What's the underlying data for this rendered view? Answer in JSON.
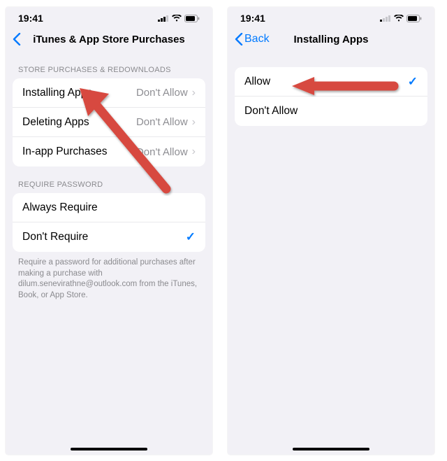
{
  "status": {
    "time": "19:41"
  },
  "left": {
    "nav_title": "iTunes & App Store Purchases",
    "section1_header": "Store Purchases & Redownloads",
    "rows1": [
      {
        "label": "Installing Apps",
        "value": "Don't Allow"
      },
      {
        "label": "Deleting Apps",
        "value": "Don't Allow"
      },
      {
        "label": "In-app Purchases",
        "value": "Don't Allow"
      }
    ],
    "section2_header": "Require Password",
    "rows2": [
      {
        "label": "Always Require",
        "checked": false
      },
      {
        "label": "Don't Require",
        "checked": true
      }
    ],
    "footer": "Require a password for additional purchases after making a purchase with dilum.senevirathne@outlook.com from the iTunes, Book, or App Store."
  },
  "right": {
    "back_label": "Back",
    "nav_title": "Installing Apps",
    "rows": [
      {
        "label": "Allow",
        "checked": true
      },
      {
        "label": "Don't Allow",
        "checked": false
      }
    ]
  }
}
